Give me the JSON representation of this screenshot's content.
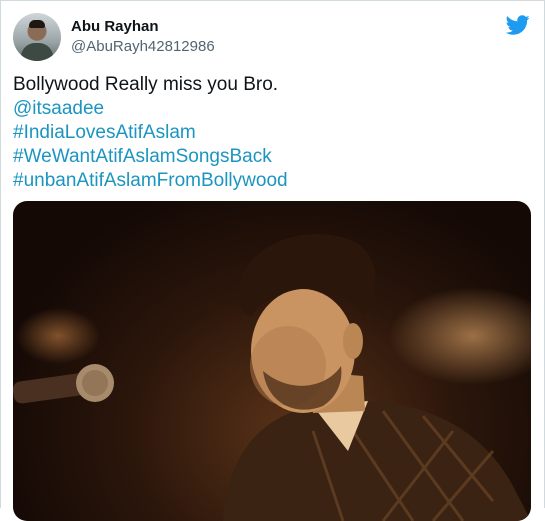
{
  "user": {
    "display_name": "Abu Rayhan",
    "handle": "@AbuRayh42812986"
  },
  "tweet": {
    "lines": [
      {
        "text": "Bollywood Really miss you Bro.",
        "type": "text"
      },
      {
        "text": "@itsaadee",
        "type": "mention"
      },
      {
        "text": "#IndiaLovesAtifAslam",
        "type": "hashtag"
      },
      {
        "text": "#WeWantAtifAslamSongsBack",
        "type": "hashtag"
      },
      {
        "text": "#unbanAtifAslamFromBollywood",
        "type": "hashtag"
      }
    ]
  },
  "icons": {
    "logo": "twitter-bird-icon",
    "avatar": "user-avatar"
  },
  "colors": {
    "link": "#1b95c0",
    "twitter_blue": "#1d9bf0",
    "handle_gray": "#536471"
  }
}
